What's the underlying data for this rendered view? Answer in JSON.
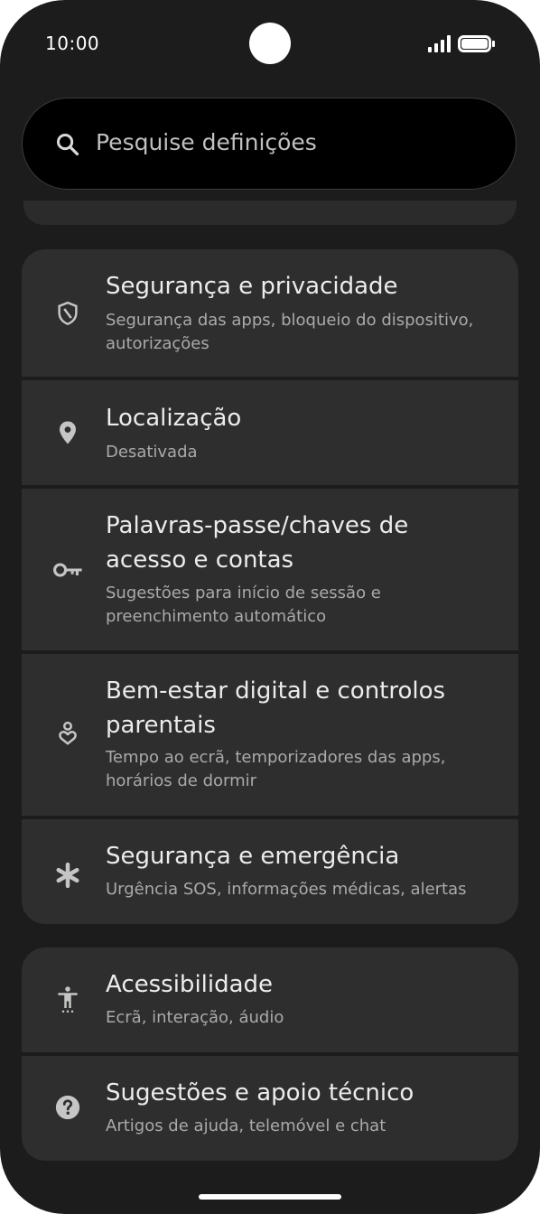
{
  "status": {
    "time": "10:00"
  },
  "search": {
    "placeholder": "Pesquise definições"
  },
  "groups": [
    {
      "items": [
        {
          "icon": "shield-icon",
          "title": "Segurança e privacidade",
          "subtitle": "Segurança das apps, bloqueio do dispositivo, autorizações"
        },
        {
          "icon": "location-pin-icon",
          "title": "Localização",
          "subtitle": "Desativada"
        },
        {
          "icon": "key-icon",
          "title": "Palavras-passe/chaves de acesso e contas",
          "subtitle": "Sugestões para início de sessão e preenchimento automático"
        },
        {
          "icon": "wellbeing-icon",
          "title": "Bem-estar digital e controlos parentais",
          "subtitle": "Tempo ao ecrã, temporizadores das apps, horários de dormir"
        },
        {
          "icon": "asterisk-icon",
          "title": "Segurança e emergência",
          "subtitle": "Urgência SOS, informações médicas, alertas"
        }
      ]
    },
    {
      "items": [
        {
          "icon": "accessibility-icon",
          "title": "Acessibilidade",
          "subtitle": "Ecrã, interação, áudio"
        },
        {
          "icon": "help-icon",
          "title": "Sugestões e apoio técnico",
          "subtitle": "Artigos de ajuda, telemóvel e chat"
        }
      ]
    }
  ],
  "colors": {
    "background": "#1b1c1b",
    "card": "#2d2e2d",
    "search": "#000000",
    "title_text": "#ececec",
    "subtitle_text": "#a9aaa9",
    "icon": "#c4c5c4"
  }
}
